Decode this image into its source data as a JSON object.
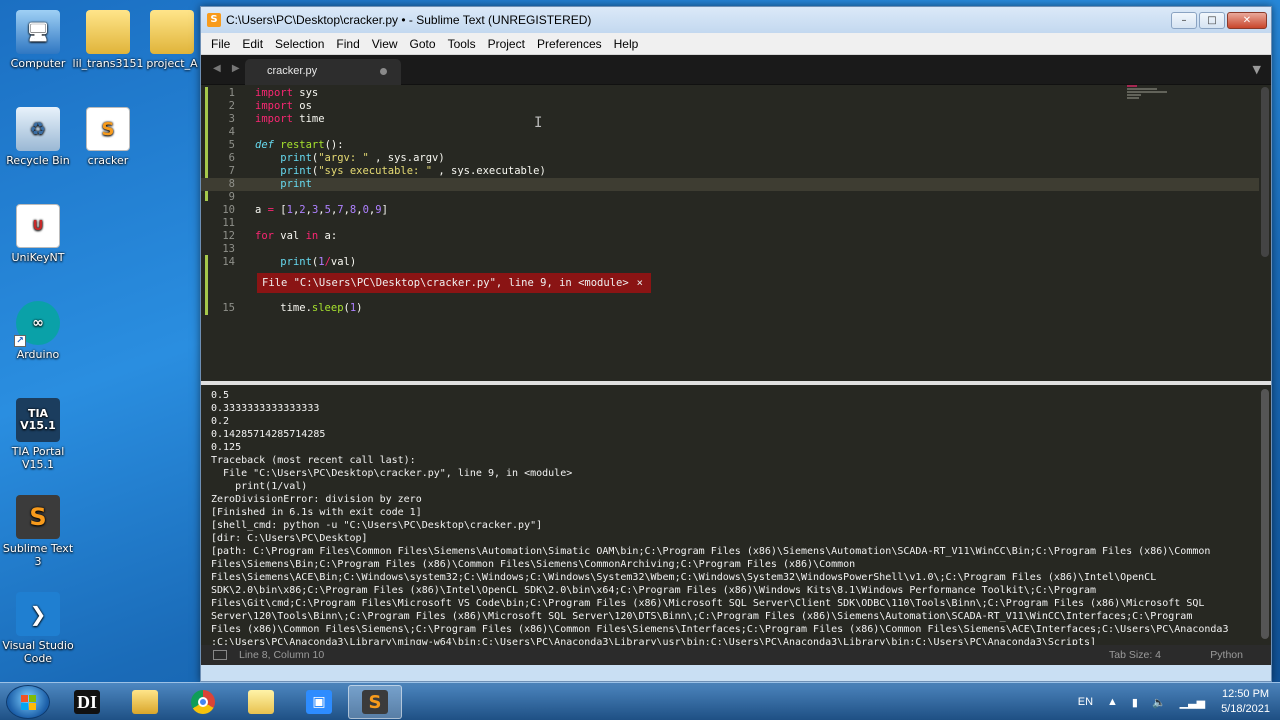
{
  "desktop": {
    "icons": [
      {
        "label": "Computer"
      },
      {
        "label": "lil_trans3151"
      },
      {
        "label": "project_A"
      },
      {
        "label": "Recycle Bin"
      },
      {
        "label": "cracker"
      },
      {
        "label": "UniKeyNT"
      },
      {
        "label": "Arduino"
      },
      {
        "label": "TIA Portal V15.1",
        "glyph": "TIA V15.1"
      },
      {
        "label": "Sublime Text 3",
        "glyph": "S"
      },
      {
        "label": "Visual Studio Code"
      }
    ]
  },
  "window": {
    "title": "C:\\Users\\PC\\Desktop\\cracker.py • - Sublime Text (UNREGISTERED)",
    "controls": {
      "minimize": "–",
      "maximize": "□",
      "close": "✕"
    }
  },
  "menu": [
    "File",
    "Edit",
    "Selection",
    "Find",
    "View",
    "Goto",
    "Tools",
    "Project",
    "Preferences",
    "Help"
  ],
  "tab": {
    "filename": "cracker.py",
    "nav": "◀ ▶",
    "dropdown": "▼"
  },
  "editor": {
    "line_numbers": [
      "1",
      "2",
      "3",
      "4",
      "5",
      "6",
      "7",
      "8",
      "9",
      "10",
      "11",
      "12",
      "13",
      "14",
      "15"
    ],
    "phantom_error": "File \"C:\\Users\\PC\\Desktop\\cracker.py\", line 9, in <module>",
    "phantom_close": "×"
  },
  "output": {
    "lines": [
      "0.5",
      "0.3333333333333333",
      "0.2",
      "0.14285714285714285",
      "0.125",
      "Traceback (most recent call last):",
      "  File \"C:\\Users\\PC\\Desktop\\cracker.py\", line 9, in <module>",
      "    print(1/val)",
      "ZeroDivisionError: division by zero",
      "[Finished in 6.1s with exit code 1]",
      "[shell_cmd: python -u \"C:\\Users\\PC\\Desktop\\cracker.py\"]",
      "[dir: C:\\Users\\PC\\Desktop]",
      "[path: C:\\Program Files\\Common Files\\Siemens\\Automation\\Simatic OAM\\bin;C:\\Program Files (x86)\\Siemens\\Automation\\SCADA-RT_V11\\WinCC\\Bin;C:\\Program Files (x86)\\Common",
      "Files\\Siemens\\Bin;C:\\Program Files (x86)\\Common Files\\Siemens\\CommonArchiving;C:\\Program Files (x86)\\Common",
      "Files\\Siemens\\ACE\\Bin;C:\\Windows\\system32;C:\\Windows;C:\\Windows\\System32\\Wbem;C:\\Windows\\System32\\WindowsPowerShell\\v1.0\\;C:\\Program Files (x86)\\Intel\\OpenCL",
      "SDK\\2.0\\bin\\x86;C:\\Program Files (x86)\\Intel\\OpenCL SDK\\2.0\\bin\\x64;C:\\Program Files (x86)\\Windows Kits\\8.1\\Windows Performance Toolkit\\;C:\\Program",
      "Files\\Git\\cmd;C:\\Program Files\\Microsoft VS Code\\bin;C:\\Program Files (x86)\\Microsoft SQL Server\\Client SDK\\ODBC\\110\\Tools\\Binn\\;C:\\Program Files (x86)\\Microsoft SQL",
      "Server\\120\\Tools\\Binn\\;C:\\Program Files (x86)\\Microsoft SQL Server\\120\\DTS\\Binn\\;C:\\Program Files (x86)\\Siemens\\Automation\\SCADA-RT_V11\\WinCC\\Interfaces;C:\\Program",
      "Files (x86)\\Common Files\\Siemens\\;C:\\Program Files (x86)\\Common Files\\Siemens\\Interfaces;C:\\Program Files (x86)\\Common Files\\Siemens\\ACE\\Interfaces;C:\\Users\\PC\\Anaconda3",
      ";C:\\Users\\PC\\Anaconda3\\Library\\mingw-w64\\bin;C:\\Users\\PC\\Anaconda3\\Library\\usr\\bin;C:\\Users\\PC\\Anaconda3\\Library\\bin;C:\\Users\\PC\\Anaconda3\\Scripts]"
    ]
  },
  "status": {
    "position": "Line 8, Column 10",
    "tab_size": "Tab Size: 4",
    "syntax": "Python"
  },
  "taskbar": {
    "apps": [
      "Start",
      "DI",
      "Explorer",
      "Chrome",
      "Folder",
      "Zoom",
      "Sublime Text"
    ],
    "language": "EN",
    "time": "12:50 PM",
    "date": "5/18/2021"
  }
}
